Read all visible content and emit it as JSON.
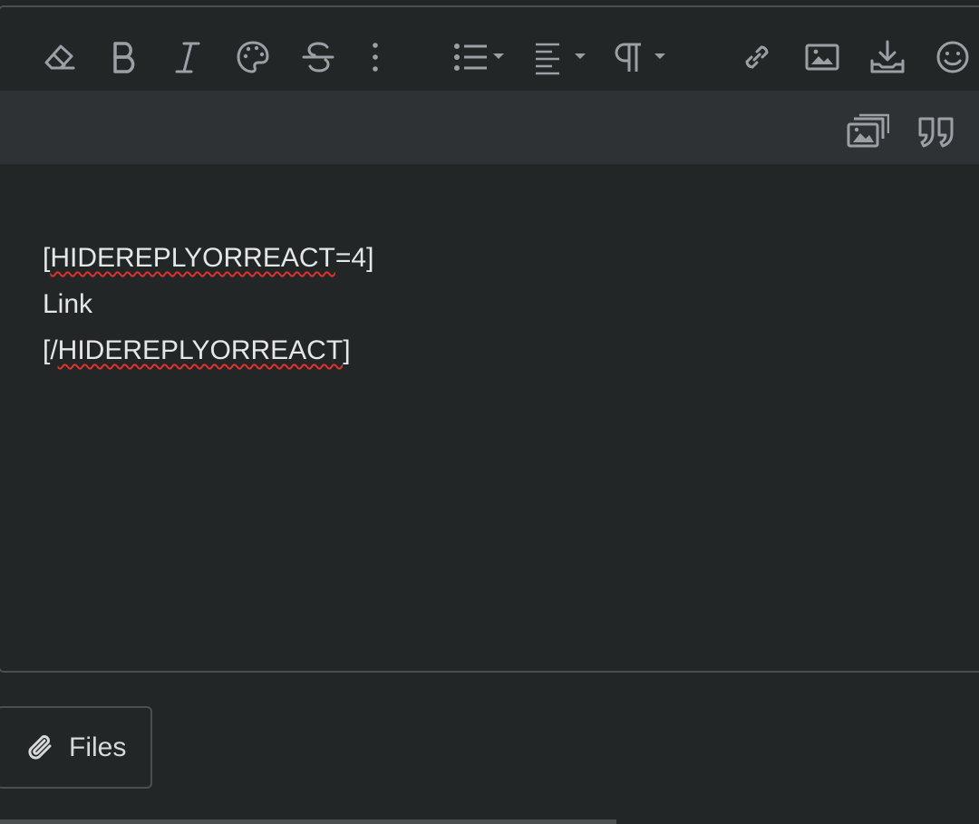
{
  "editor": {
    "content_lines": [
      {
        "prefix": "[",
        "word": "HIDEREPLYORREACT",
        "suffix": "=4]"
      },
      {
        "prefix": "",
        "word": "Link",
        "suffix": ""
      },
      {
        "prefix": "[/",
        "word": "HIDEREPLYORREACT",
        "suffix": "]"
      }
    ]
  },
  "toolbar": {
    "icons": [
      "eraser-icon",
      "bold-icon",
      "italic-icon",
      "palette-icon",
      "strikethrough-icon",
      "more-vertical-icon",
      "list-icon",
      "align-icon",
      "paragraph-icon",
      "link-icon",
      "image-icon",
      "download-icon",
      "smiley-icon",
      "gallery-icon",
      "quote-icon"
    ]
  },
  "attachments": {
    "files_label": "Files"
  },
  "colors": {
    "background": "#232627",
    "toolbar_row2": "#2e3235",
    "icon": "#9aa0a4",
    "text": "#e4e6e7",
    "spellcheck": "#e0312a"
  }
}
